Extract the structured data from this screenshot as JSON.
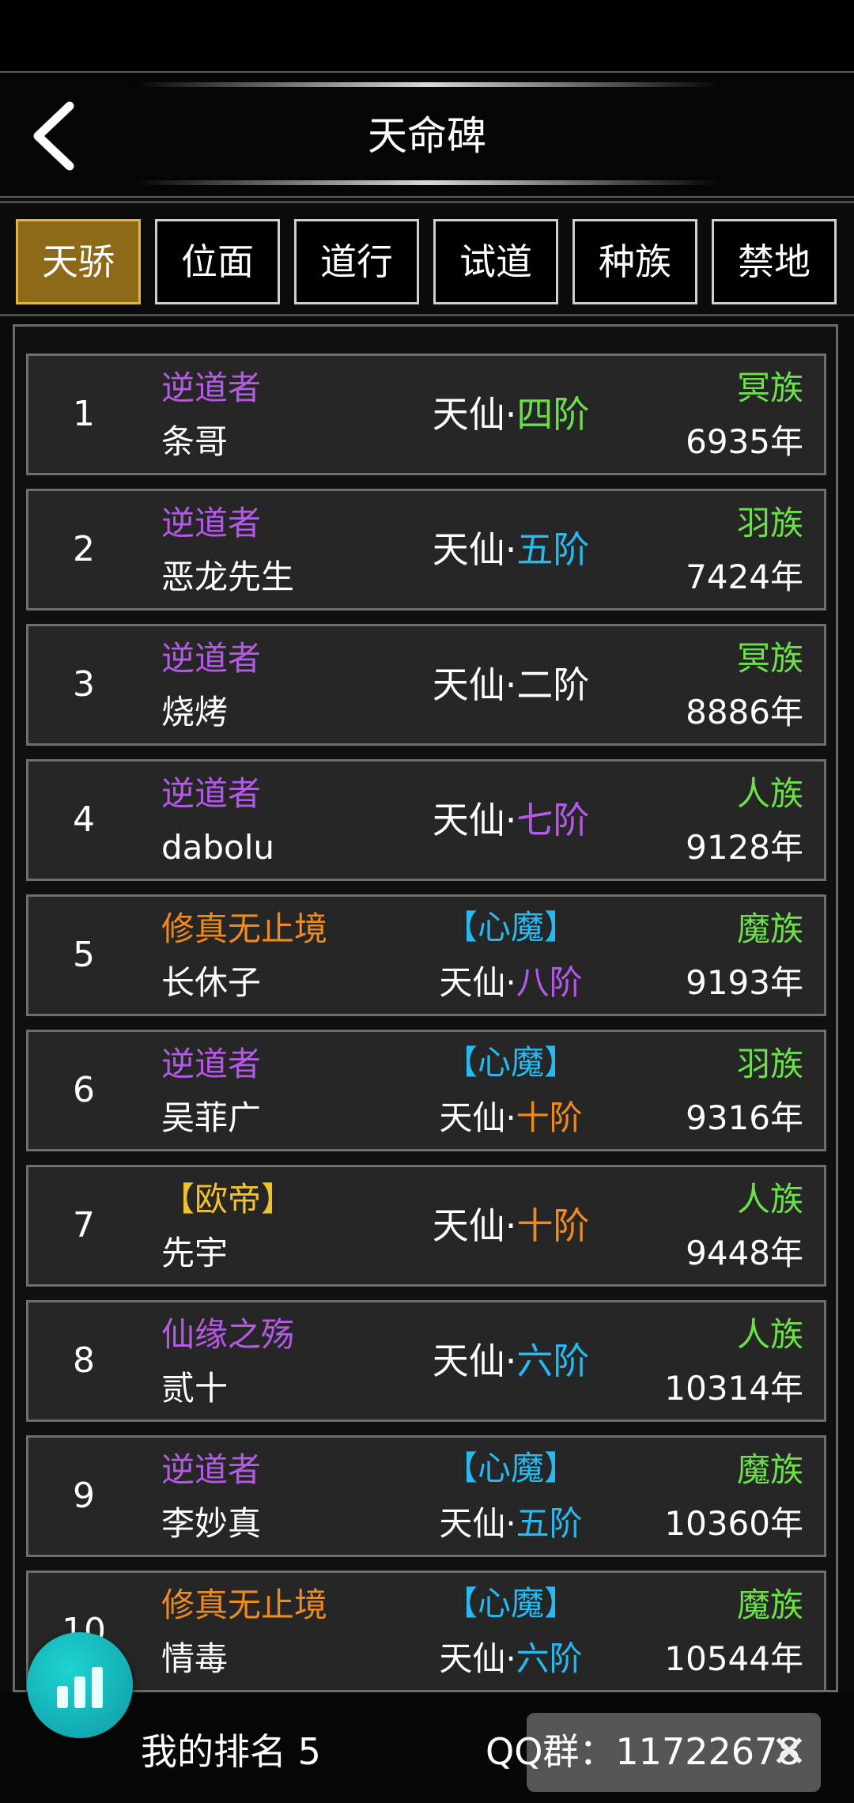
{
  "header": {
    "title": "天命碑"
  },
  "tabs": [
    {
      "label": "天骄",
      "active": true
    },
    {
      "label": "位面",
      "active": false
    },
    {
      "label": "道行",
      "active": false
    },
    {
      "label": "试道",
      "active": false
    },
    {
      "label": "种族",
      "active": false
    },
    {
      "label": "禁地",
      "active": false
    }
  ],
  "rows": [
    {
      "rank": "1",
      "title": "逆道者",
      "name": "条哥",
      "realm": "天仙·",
      "stage": "四阶",
      "race": "冥族",
      "age": "6935年"
    },
    {
      "rank": "2",
      "title": "逆道者",
      "name": "恶龙先生",
      "realm": "天仙·",
      "stage": "五阶",
      "race": "羽族",
      "age": "7424年"
    },
    {
      "rank": "3",
      "title": "逆道者",
      "name": "烧烤",
      "realm": "天仙·",
      "stage": "二阶",
      "race": "冥族",
      "age": "8886年"
    },
    {
      "rank": "4",
      "title": "逆道者",
      "name": "dabolu",
      "realm": "天仙·",
      "stage": "七阶",
      "race": "人族",
      "age": "9128年"
    },
    {
      "rank": "5",
      "title": "修真无止境",
      "name": "长休子",
      "demon": "【心魔】",
      "realm": "天仙·",
      "stage": "八阶",
      "race": "魔族",
      "age": "9193年"
    },
    {
      "rank": "6",
      "title": "逆道者",
      "name": "吴菲广",
      "demon": "【心魔】",
      "realm": "天仙·",
      "stage": "十阶",
      "race": "羽族",
      "age": "9316年"
    },
    {
      "rank": "7",
      "title": "【欧帝】",
      "name": "先宇",
      "realm": "天仙·",
      "stage": "十阶",
      "race": "人族",
      "age": "9448年"
    },
    {
      "rank": "8",
      "title": "仙缘之殇",
      "name": "贰十",
      "realm": "天仙·",
      "stage": "六阶",
      "race": "人族",
      "age": "10314年"
    },
    {
      "rank": "9",
      "title": "逆道者",
      "name": "李妙真",
      "demon": "【心魔】",
      "realm": "天仙·",
      "stage": "五阶",
      "race": "魔族",
      "age": "10360年"
    },
    {
      "rank": "10",
      "title": "修真无止境",
      "name": "情毒",
      "demon": "【心魔】",
      "realm": "天仙·",
      "stage": "六阶",
      "race": "魔族",
      "age": "10544年"
    }
  ],
  "footer": {
    "my_rank": "我的排名 5",
    "qq_group": "QQ群：11722678"
  },
  "colors": {
    "active_tab": "#8d6a17",
    "purple": "#b45ae6",
    "orange": "#f08a1e",
    "gold": "#f2c12e",
    "green": "#6be04a",
    "cyan": "#27b9ef",
    "fab": "#15b8bd"
  },
  "icons": {
    "back": "chevron-left-icon",
    "fab": "bar-chart-icon",
    "overlay_close": "close-icon"
  }
}
